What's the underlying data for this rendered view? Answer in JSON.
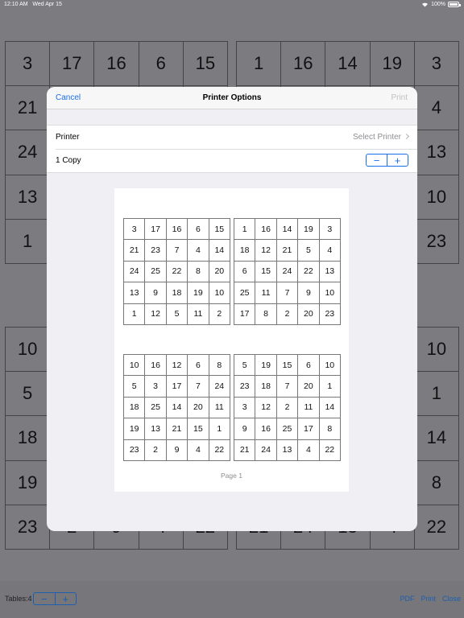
{
  "status": {
    "time": "12:10 AM",
    "date": "Wed Apr 15",
    "battery": "100%"
  },
  "background": {
    "tables": [
      {
        "cells": [
          "3",
          "17",
          "16",
          "6",
          "15",
          "21",
          "",
          "",
          "",
          "",
          "24",
          "",
          "",
          "",
          "",
          "13",
          "",
          "",
          "",
          "",
          "1",
          "",
          "",
          "",
          ""
        ]
      },
      {
        "cells": [
          "1",
          "16",
          "14",
          "19",
          "3",
          "",
          "",
          "",
          "",
          "4",
          "",
          "",
          "",
          "",
          "13",
          "",
          "",
          "",
          "",
          "10",
          "",
          "",
          "",
          "",
          "23"
        ]
      },
      {
        "cells": [
          "10",
          "",
          "",
          "",
          "",
          "5",
          "",
          "",
          "",
          "",
          "18",
          "",
          "",
          "",
          "",
          "19",
          "",
          "",
          "",
          "",
          "23",
          "2",
          "9",
          "4",
          "22"
        ]
      },
      {
        "cells": [
          "",
          "",
          "",
          "",
          "10",
          "",
          "",
          "",
          "",
          "1",
          "",
          "",
          "",
          "",
          "14",
          "",
          "",
          "",
          "",
          "8",
          "21",
          "24",
          "13",
          "4",
          "22"
        ]
      }
    ],
    "tables_label": "Tables:4",
    "stepper": {
      "minus": "−",
      "plus": "+"
    },
    "links": [
      "PDF",
      "Print",
      "Close"
    ]
  },
  "modal": {
    "cancel": "Cancel",
    "title": "Printer Options",
    "print": "Print",
    "printer_label": "Printer",
    "printer_value": "Select Printer",
    "copies_label": "1 Copy",
    "stepper": {
      "minus": "−",
      "plus": "+"
    },
    "page_label": "Page 1",
    "tables": [
      {
        "cells": [
          "3",
          "17",
          "16",
          "6",
          "15",
          "21",
          "23",
          "7",
          "4",
          "14",
          "24",
          "25",
          "22",
          "8",
          "20",
          "13",
          "9",
          "18",
          "19",
          "10",
          "1",
          "12",
          "5",
          "11",
          "2"
        ]
      },
      {
        "cells": [
          "1",
          "16",
          "14",
          "19",
          "3",
          "18",
          "12",
          "21",
          "5",
          "4",
          "6",
          "15",
          "24",
          "22",
          "13",
          "25",
          "11",
          "7",
          "9",
          "10",
          "17",
          "8",
          "2",
          "20",
          "23"
        ]
      },
      {
        "cells": [
          "10",
          "16",
          "12",
          "6",
          "8",
          "5",
          "3",
          "17",
          "7",
          "24",
          "18",
          "25",
          "14",
          "20",
          "11",
          "19",
          "13",
          "21",
          "15",
          "1",
          "23",
          "2",
          "9",
          "4",
          "22"
        ]
      },
      {
        "cells": [
          "5",
          "19",
          "15",
          "6",
          "10",
          "23",
          "18",
          "7",
          "20",
          "1",
          "3",
          "12",
          "2",
          "11",
          "14",
          "9",
          "16",
          "25",
          "17",
          "8",
          "21",
          "24",
          "13",
          "4",
          "22"
        ]
      }
    ]
  }
}
